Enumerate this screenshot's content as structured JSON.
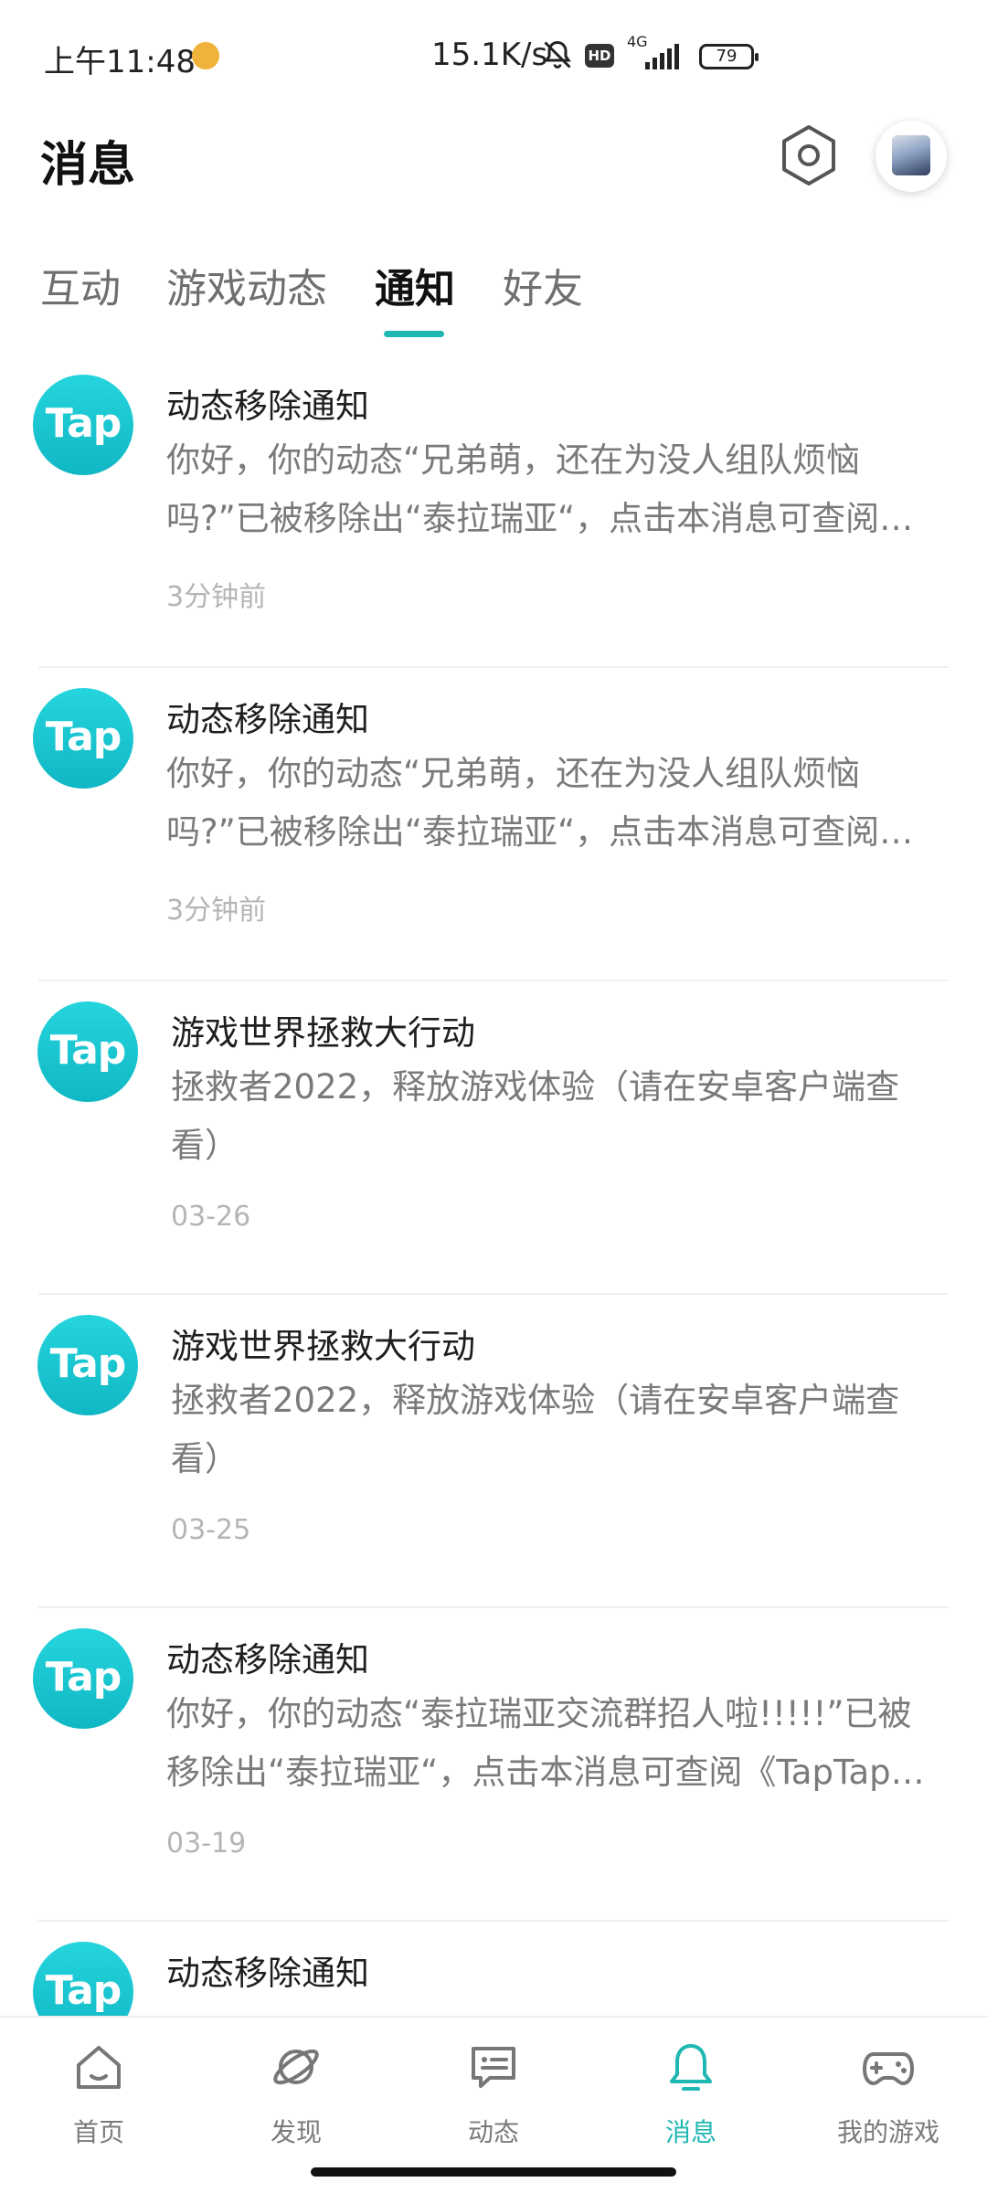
{
  "status_bar": {
    "time": "上午11:48",
    "net_speed": "15.1K/s",
    "hd": "HD",
    "network_type": "4G",
    "battery": "79"
  },
  "header": {
    "title": "消息"
  },
  "tabs": [
    {
      "label": "互动",
      "active": false
    },
    {
      "label": "游戏动态",
      "active": false
    },
    {
      "label": "通知",
      "active": true
    },
    {
      "label": "好友",
      "active": false
    }
  ],
  "notifications": [
    {
      "logo": "Tap",
      "title": "动态移除通知",
      "body": "你好，你的动态“兄弟萌，还在为没人组队烦恼吗?”已被移除出“泰拉瑞亚“，点击本消息可查阅《TapTap社区规范》",
      "time": "3分钟前"
    },
    {
      "logo": "Tap",
      "title": "动态移除通知",
      "body": "你好，你的动态“兄弟萌，还在为没人组队烦恼吗?”已被移除出“泰拉瑞亚“，点击本消息可查阅《TapTap社区规范》",
      "time": "3分钟前"
    },
    {
      "logo": "Tap",
      "title": "游戏世界拯救大行动",
      "body": "拯救者2022，释放游戏体验（请在安卓客户端查看）",
      "time": "03-26"
    },
    {
      "logo": "Tap",
      "title": "游戏世界拯救大行动",
      "body": "拯救者2022，释放游戏体验（请在安卓客户端查看）",
      "time": "03-25"
    },
    {
      "logo": "Tap",
      "title": "动态移除通知",
      "body": "你好，你的动态“泰拉瑞亚交流群招人啦!!!!!”已被移除出“泰拉瑞亚“，点击本消息可查阅《TapTap社区规范》",
      "time": "03-19"
    },
    {
      "logo": "Tap",
      "title": "动态移除通知",
      "body": "",
      "time": ""
    }
  ],
  "bottom_nav": [
    {
      "label": "首页",
      "icon": "home-icon",
      "active": false
    },
    {
      "label": "发现",
      "icon": "planet-icon",
      "active": false
    },
    {
      "label": "动态",
      "icon": "chat-bubble-icon",
      "active": false
    },
    {
      "label": "消息",
      "icon": "bell-icon",
      "active": true
    },
    {
      "label": "我的游戏",
      "icon": "gamepad-icon",
      "active": false
    }
  ],
  "colors": {
    "accent": "#1fb7b2",
    "logo": "#14c3cc"
  }
}
